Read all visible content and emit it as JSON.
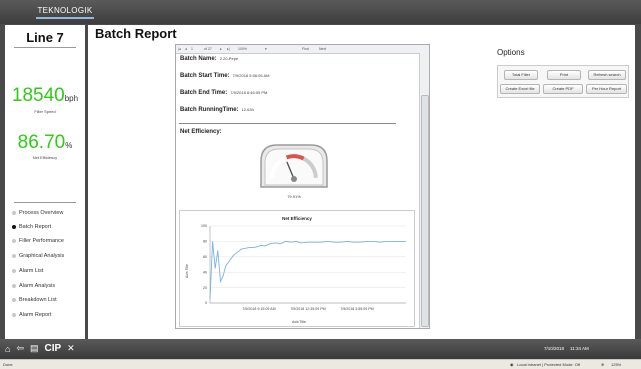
{
  "app": {
    "logo_text": "TEKNOLOGIK"
  },
  "sidebar": {
    "title": "Line 7",
    "metric1": {
      "value": "18540",
      "unit": "bph",
      "label": "Filler Speed"
    },
    "metric2": {
      "value": "86.70",
      "unit": "%",
      "label": "Net Efficiency"
    },
    "items": [
      {
        "label": "Process Overview",
        "active": false
      },
      {
        "label": "Batch Report",
        "active": true
      },
      {
        "label": "Filler Performance",
        "active": false
      },
      {
        "label": "Graphical Analysis",
        "active": false
      },
      {
        "label": "Alarm List",
        "active": false
      },
      {
        "label": "Alarm Analysis",
        "active": false
      },
      {
        "label": "Breakdown List",
        "active": false
      },
      {
        "label": "Alarm Report",
        "active": false
      }
    ]
  },
  "main": {
    "title": "Batch Report"
  },
  "report": {
    "toolbar": {
      "page": "1",
      "of_pages": "of 27",
      "zoom": "100%",
      "find": "Find",
      "next": "Next"
    },
    "batch_name_label": "Batch Name:",
    "batch_name": "2.20-Pepe",
    "start_label": "Batch Start Time:",
    "start_value": "7/9/2018 5:56:05 AM",
    "end_label": "Batch End Time:",
    "end_value": "7/9/2018 8:46:09 PM",
    "running_label": "Batch RunningTime:",
    "running_value": "12.63h",
    "net_eff_label": "Net Efficiency:",
    "gauge": {
      "value_pct": 79.91,
      "display": "79.91%"
    }
  },
  "chart_data": {
    "type": "line",
    "title": "Net Efficiency",
    "xlabel": "Axis Title",
    "ylabel": "Axis Title",
    "ylim": [
      0,
      100
    ],
    "yticks": [
      0,
      20,
      40,
      60,
      80,
      100
    ],
    "xtick_labels": [
      "7/9/2018 9:15:09 AM",
      "7/9/2018 12:35:09 PM",
      "7/9/2018 3:55:09 PM"
    ],
    "x": [
      0.0,
      0.2,
      0.4,
      0.6,
      0.8,
      1.0,
      1.2,
      1.5,
      1.8,
      2.1,
      2.4,
      2.7,
      3.0,
      3.3,
      3.6,
      3.9,
      4.2,
      4.6,
      5.0,
      5.4,
      5.8,
      6.2,
      6.6,
      7.0,
      7.5,
      8.0,
      8.5,
      9.0,
      9.5,
      10.0,
      10.5,
      11.0,
      11.5,
      12.0,
      12.5,
      13.0,
      13.5,
      14.0,
      14.5,
      15.0
    ],
    "values": [
      5,
      80,
      45,
      68,
      28,
      35,
      48,
      55,
      62,
      66,
      70,
      71,
      72,
      72,
      73,
      75,
      74,
      77,
      78,
      77,
      80,
      79,
      80,
      78,
      79,
      79,
      79,
      80,
      79,
      79,
      80,
      79,
      79,
      80,
      80,
      79,
      80,
      80,
      80,
      80
    ]
  },
  "options": {
    "title": "Options",
    "buttons": [
      "Total Filler",
      "Print",
      "Refresh search",
      "Create Excel file",
      "Create PDF",
      "Per Hour Report"
    ]
  },
  "footer": {
    "cip_label": "CIP",
    "date": "7/10/2018",
    "time": "11:34 AM"
  },
  "statusbar": {
    "left": "Done",
    "zone": "Local intranet | Protected Mode: Off",
    "zoom": "125%"
  },
  "colors": {
    "accent_green": "#2ecc14",
    "gauge_red": "#d9534f",
    "chart_line": "#7ab1e6"
  }
}
